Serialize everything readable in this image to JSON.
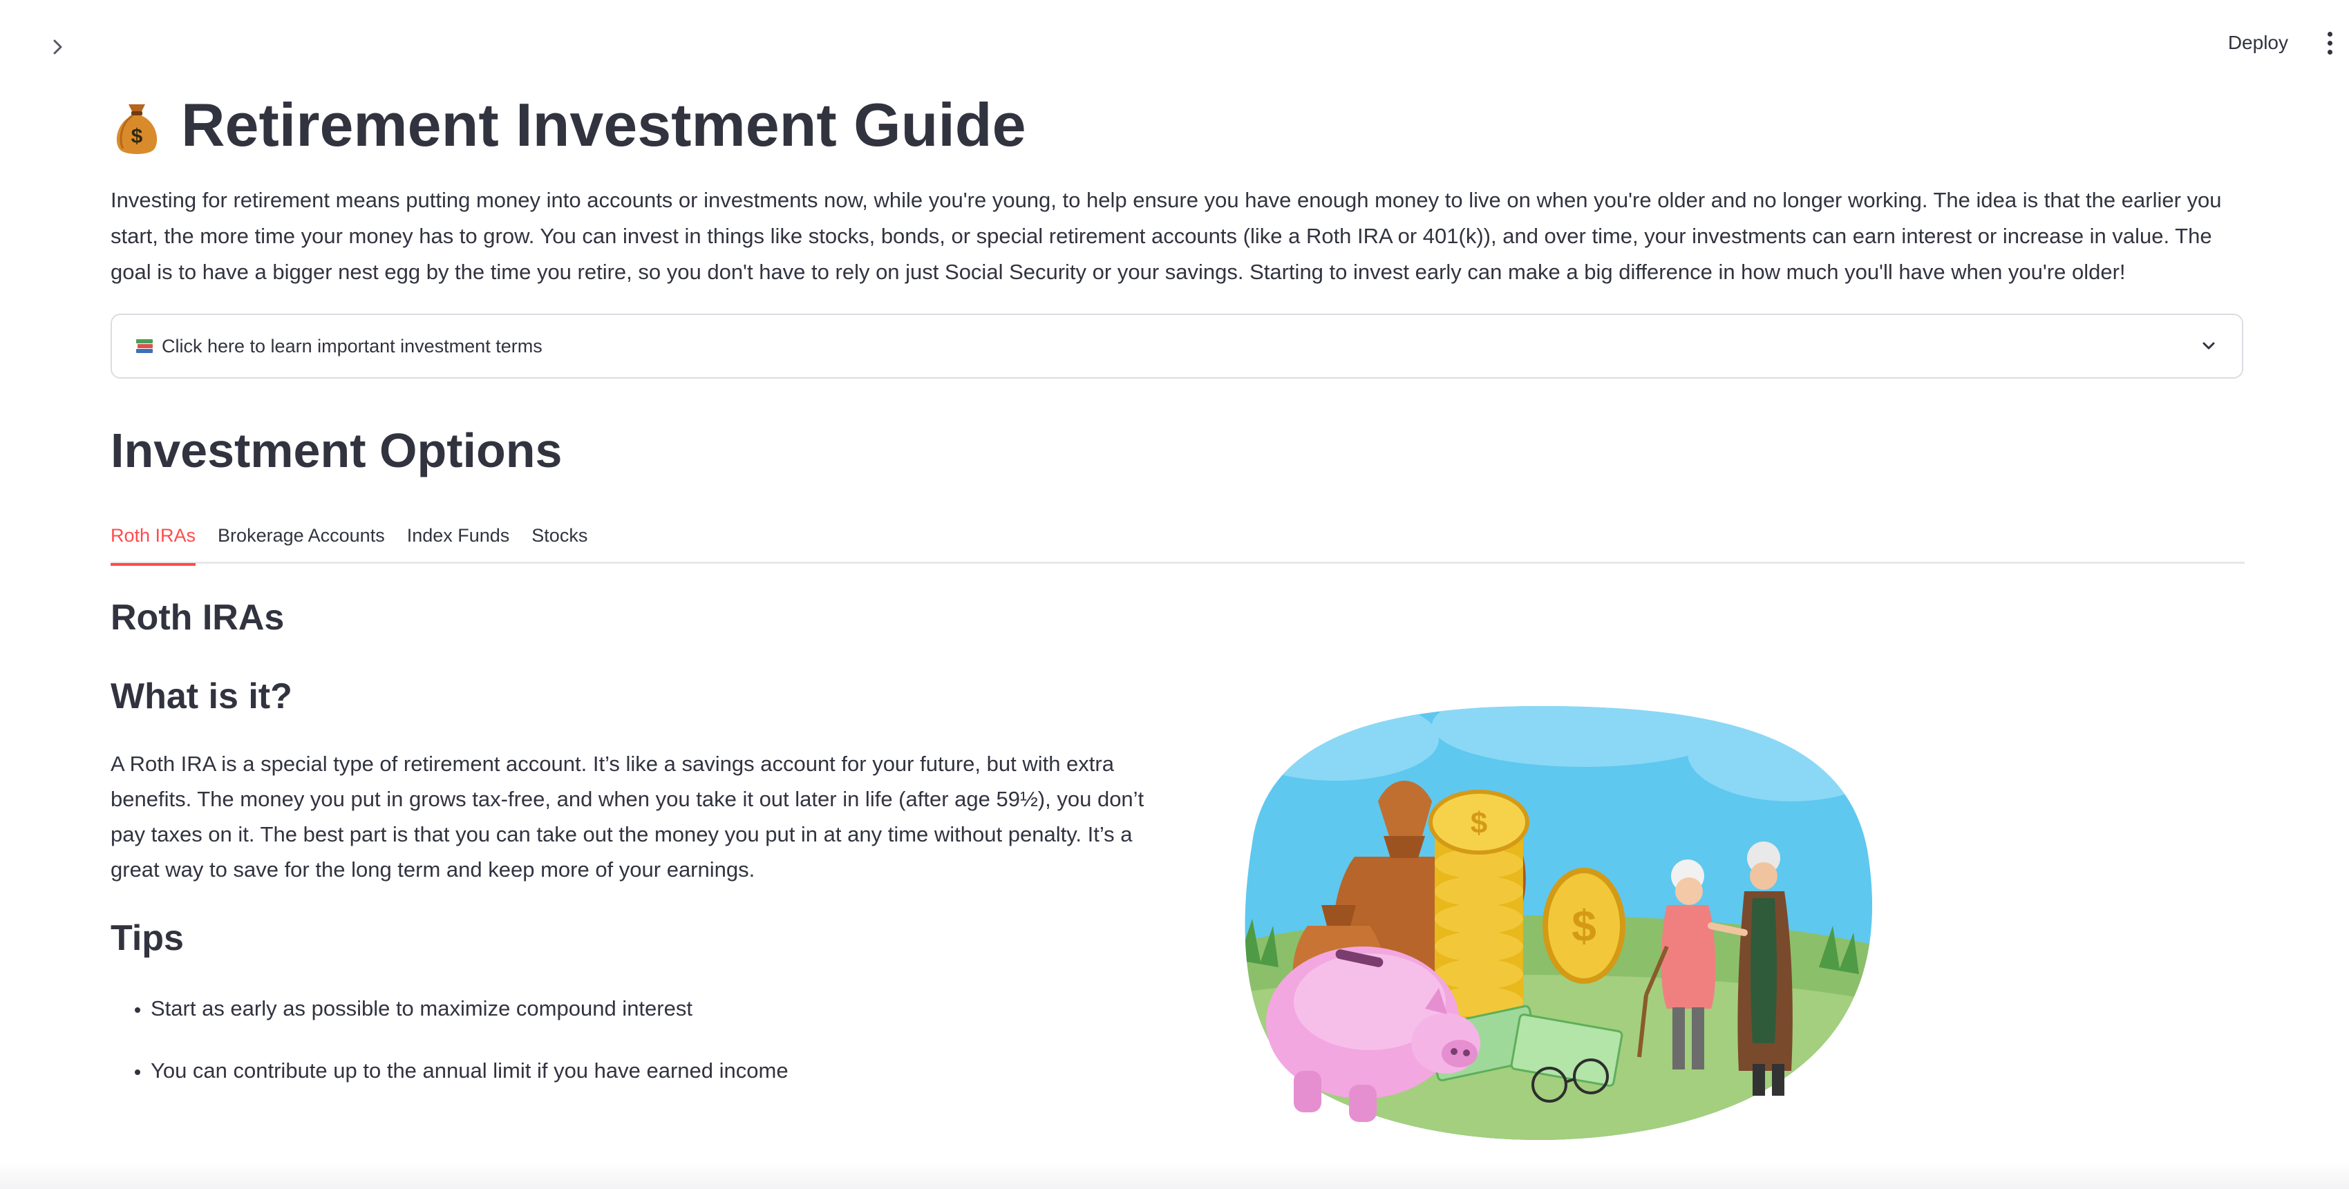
{
  "header": {
    "deploy_label": "Deploy"
  },
  "page": {
    "title_icon": "money-bag-icon",
    "title": "Retirement Investment Guide",
    "intro": "Investing for retirement means putting money into accounts or investments now, while you're young, to help ensure you have enough money to live on when you're older and no longer working. The idea is that the earlier you start, the more time your money has to grow. You can invest in things like stocks, bonds, or special retirement accounts (like a Roth IRA or 401(k)), and over time, your investments can earn interest or increase in value. The goal is to have a bigger nest egg by the time you retire, so you don't have to rely on just Social Security or your savings. Starting to invest early can make a big difference in how much you'll have when you're older!"
  },
  "expander": {
    "icon": "books-icon",
    "label": "Click here to learn important investment terms"
  },
  "options": {
    "heading": "Investment Options",
    "tabs": [
      {
        "label": "Roth IRAs",
        "active": true
      },
      {
        "label": "Brokerage Accounts",
        "active": false
      },
      {
        "label": "Index Funds",
        "active": false
      },
      {
        "label": "Stocks",
        "active": false
      }
    ],
    "active_tab": {
      "heading": "Roth IRAs",
      "what_heading": "What is it?",
      "description": "A Roth IRA is a special type of retirement account. It’s like a savings account for your future, but with extra benefits. The money you put in grows tax-free, and when you take it out later in life (after age 59½), you don’t pay taxes on it. The best part is that you can take out the money you put in at any time without penalty. It’s a great way to save for the long term and keep more of your earnings.",
      "tips_heading": "Tips",
      "tips": [
        "Start as early as possible to maximize compound interest",
        "You can contribute up to the annual limit if you have earned income"
      ]
    }
  },
  "colors": {
    "accent": "#ff4b4b",
    "text": "#31333f",
    "border": "#dcdde2"
  }
}
